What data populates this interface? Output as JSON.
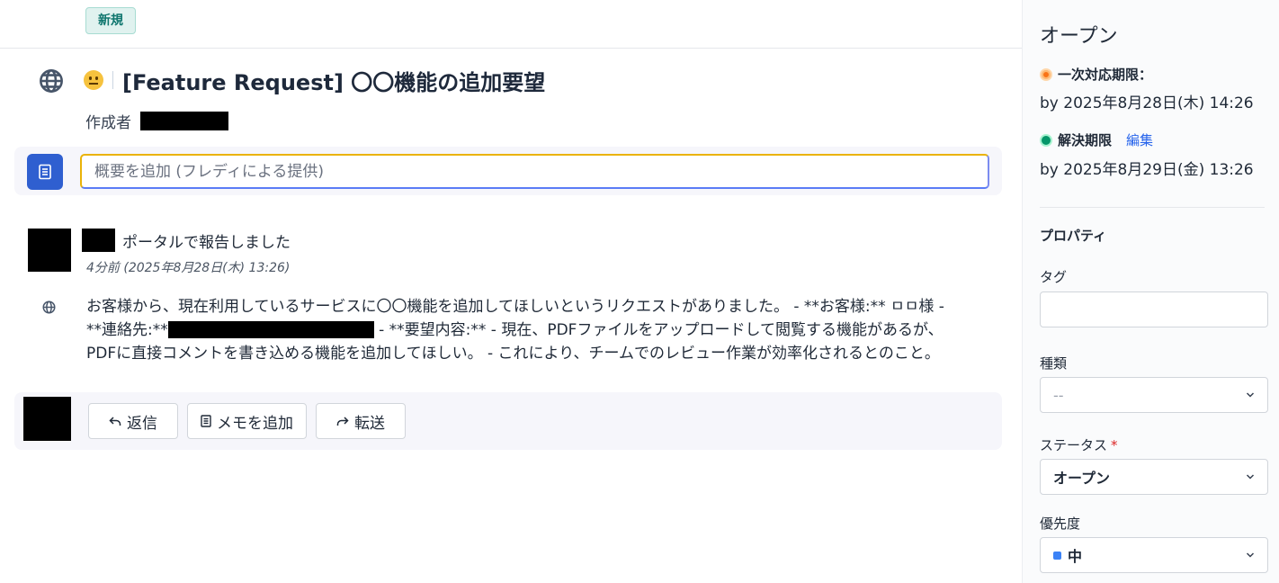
{
  "header": {
    "badge": "新規"
  },
  "ticket": {
    "title": "[Feature Request] 〇〇機能の追加要望",
    "creator_label": "作成者"
  },
  "summary": {
    "placeholder": "概要を追加 (フレディによる提供)"
  },
  "message": {
    "action": "ポータルで報告しました",
    "time": "4分前 (2025年8月28日(木) 13:26)",
    "line1": "お客様から、現在利用しているサービスに〇〇機能を追加してほしいというリクエストがありました。 - **お客様:** ㅁㅁ様 -",
    "line2_start": "**連絡先:**",
    "line2_end": " - **要望内容:** - 現在、PDFファイルをアップロードして閲覧する機能があるが、",
    "line3": "PDFに直接コメントを書き込める機能を追加してほしい。 - これにより、チームでのレビュー作業が効率化されるとのこと。"
  },
  "actions": {
    "reply": "返信",
    "add_note": "メモを追加",
    "forward": "転送"
  },
  "sidebar": {
    "status_title": "オープン",
    "first_response_label": "一次対応期限：",
    "first_response_value": "by 2025年8月28日(木) 14:26",
    "resolution_label": "解決期限",
    "edit_link": "編集",
    "resolution_value": "by 2025年8月29日(金) 13:26",
    "properties_title": "プロパティ",
    "tag_label": "タグ",
    "type_label": "種類",
    "type_value": "--",
    "status_label": "ステータス",
    "required_mark": "*",
    "status_value": "オープン",
    "priority_label": "優先度",
    "priority_value": "中"
  },
  "colors": {
    "primary": "#2f5fd0",
    "sla_orange": "#f97316",
    "sla_green": "#059669",
    "priority_medium": "#3b82f6",
    "badge_new": "#0f766e"
  }
}
